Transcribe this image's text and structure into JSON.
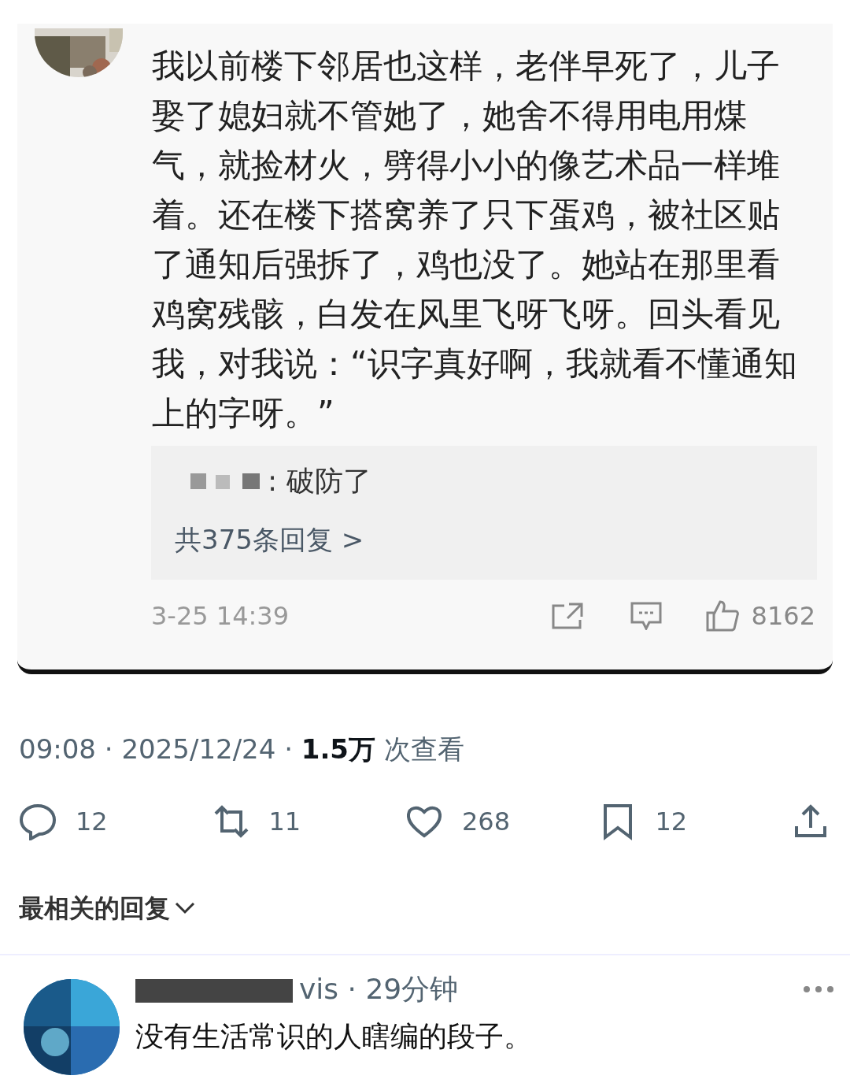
{
  "embedded_comment": {
    "text": "我以前楼下邻居也这样，老伴早死了，儿子娶了媳妇就不管她了，她舍不得用电用煤气，就捡材火，劈得小小的像艺术品一样堆着。还在楼下搭窝养了只下蛋鸡，被社区贴了通知后强拆了，鸡也没了。她站在那里看鸡窝残骸，白发在风里飞呀飞呀。回头看见我，对我说：“识字真好啊，我就看不懂通知上的字呀。”",
    "reply_preview": ": 破防了",
    "reply_count": "共375条回复 >",
    "timestamp": "3-25 14:39",
    "like_count": "8162"
  },
  "tweet_meta": "09:08 · 2025/12/24 · **1.5万** 次查看",
  "actions": [
    {
      "kind": "reply",
      "count": "12"
    },
    {
      "kind": "repost",
      "count": "11"
    },
    {
      "kind": "like",
      "count": "268"
    },
    {
      "kind": "bookmark",
      "count": "12"
    },
    {
      "kind": "share"
    }
  ],
  "sort_label": "最相关的回复",
  "reply": {
    "meta": "vis · 29分钟",
    "text": "没有生活常识的人瞎编的段子。"
  }
}
